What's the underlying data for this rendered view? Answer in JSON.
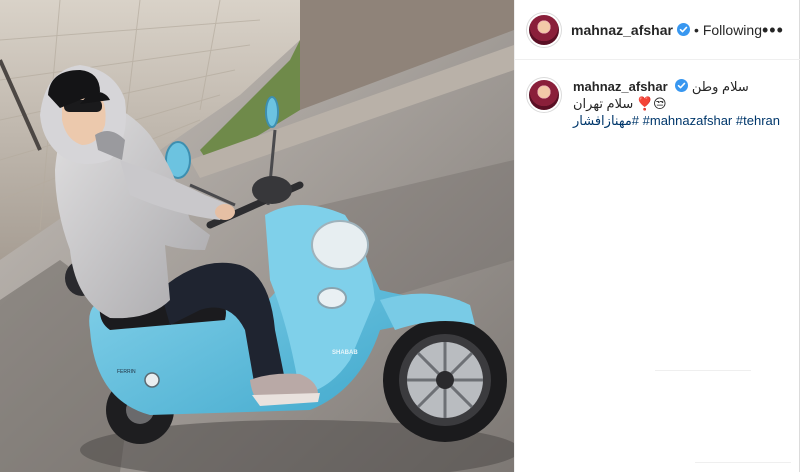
{
  "post": {
    "image_alt": "woman riding a light blue scooter",
    "scooter_brand": "SHABAB",
    "scooter_model": "FERRIN"
  },
  "header": {
    "username": "mahnaz_afshar",
    "separator": "•",
    "follow_status": "Following",
    "more_icon": "ellipsis-icon"
  },
  "caption": {
    "username": "mahnaz_afshar",
    "line1": "سلام وطن",
    "line2": "😒❣️ سلام تهران",
    "hashtags": [
      "#مهنازافشار",
      "#mahnazafshar",
      "#tehran"
    ]
  },
  "colors": {
    "link": "#00376b",
    "verified": "#3897f0",
    "scooter": "#6fc4e0",
    "text": "#262626"
  }
}
